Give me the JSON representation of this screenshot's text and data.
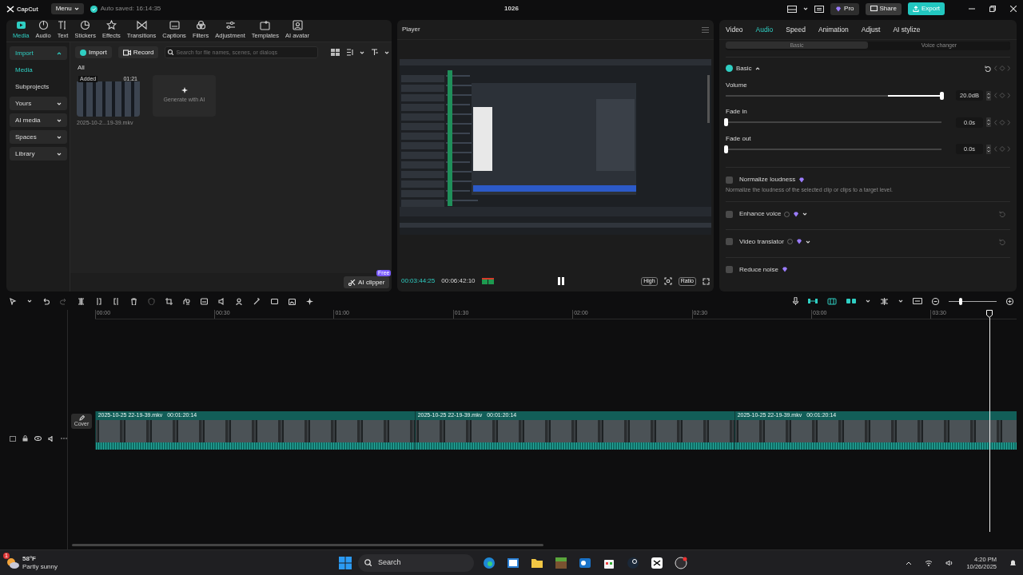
{
  "title_bar": {
    "app_name": "CapCut",
    "menu": "Menu",
    "autosave": "Auto saved: 16:14:35",
    "project": "1026",
    "pro": "Pro",
    "share": "Share",
    "export": "Export"
  },
  "toolbar_tabs": [
    {
      "label": "Media",
      "selected": true
    },
    {
      "label": "Audio",
      "selected": false
    },
    {
      "label": "Text",
      "selected": false
    },
    {
      "label": "Stickers",
      "selected": false
    },
    {
      "label": "Effects",
      "selected": false
    },
    {
      "label": "Transitions",
      "selected": false
    },
    {
      "label": "Captions",
      "selected": false
    },
    {
      "label": "Filters",
      "selected": false
    },
    {
      "label": "Adjustment",
      "selected": false
    },
    {
      "label": "Templates",
      "selected": false
    },
    {
      "label": "AI avatar",
      "selected": false
    }
  ],
  "sidebar": [
    {
      "label": "Import",
      "kind": "group",
      "selected": true,
      "expanded": true
    },
    {
      "label": "Media",
      "kind": "item",
      "selected": true
    },
    {
      "label": "Subprojects",
      "kind": "item",
      "selected": false
    },
    {
      "label": "Yours",
      "kind": "group",
      "selected": false,
      "expanded": false
    },
    {
      "label": "AI media",
      "kind": "group",
      "selected": false,
      "expanded": false
    },
    {
      "label": "Spaces",
      "kind": "group",
      "selected": false,
      "expanded": false
    },
    {
      "label": "Library",
      "kind": "group",
      "selected": false,
      "expanded": false
    }
  ],
  "media": {
    "import": "Import",
    "record": "Record",
    "search_placeholder": "Search for file names, scenes, or dialogs",
    "filter": "All",
    "clip": {
      "badge": "Added",
      "duration": "01:21",
      "name": "2025-10-2...19-39.mkv"
    },
    "generate": "Generate with AI",
    "ai_clipper": "AI clipper",
    "free_badge": "Free"
  },
  "player": {
    "title": "Player",
    "current_time": "00:03:44:25",
    "total_time": "00:06:42:10",
    "quality": "High",
    "ratio": "Ratio"
  },
  "inspector": {
    "tabs": [
      {
        "label": "Video",
        "selected": false
      },
      {
        "label": "Audio",
        "selected": true
      },
      {
        "label": "Speed",
        "selected": false
      },
      {
        "label": "Animation",
        "selected": false
      },
      {
        "label": "Adjust",
        "selected": false
      },
      {
        "label": "AI stylize",
        "selected": false
      }
    ],
    "subtabs": [
      {
        "label": "Basic",
        "selected": true
      },
      {
        "label": "Voice changer",
        "selected": false
      }
    ],
    "section": {
      "label": "Basic",
      "checked": true,
      "expanded": true
    },
    "sliders": [
      {
        "label": "Volume",
        "kind": "bipolar",
        "level": 1,
        "reading": "20.0dB"
      },
      {
        "label": "Fade in",
        "kind": "plain",
        "level": 0,
        "reading": "0.0s"
      },
      {
        "label": "Fade out",
        "kind": "plain",
        "level": 0,
        "reading": "0.0s"
      }
    ],
    "options": [
      {
        "label": "Normalize loudness",
        "checked": false,
        "help": false,
        "dropdown": false,
        "reset": false,
        "description": "Normalize the loudness of the selected clip or clips to a target level."
      },
      {
        "label": "Enhance voice",
        "checked": false,
        "help": true,
        "dropdown": true,
        "reset": true
      },
      {
        "label": "Video translator",
        "checked": false,
        "help": true,
        "dropdown": true,
        "reset": true
      },
      {
        "label": "Reduce noise",
        "checked": false,
        "help": false,
        "dropdown": false,
        "reset": false
      }
    ]
  },
  "timeline": {
    "zoom": {
      "level": 0.25
    },
    "ruler": [
      "00:00",
      "00:30",
      "01:00",
      "01:30",
      "02:00",
      "02:30",
      "03:00",
      "03:30"
    ],
    "cover": "Cover",
    "clips": [
      {
        "name": "2025-10-25 22-19-39.mkv",
        "duration": "00:01:20:14"
      },
      {
        "name": "2025-10-25 22-19-39.mkv",
        "duration": "00:01:20:14"
      },
      {
        "name": "2025-10-25 22-19-39.mkv",
        "duration": "00:01:20:14"
      }
    ]
  },
  "taskbar": {
    "notification_count": "1",
    "temperature": "58°F",
    "weather": "Partly sunny",
    "search": "Search",
    "time": "4:20 PM",
    "date": "10/26/2025"
  }
}
